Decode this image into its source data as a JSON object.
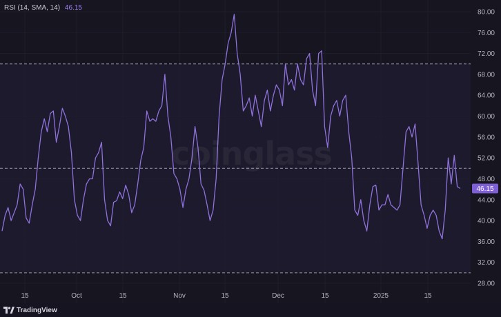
{
  "header": {
    "indicator_label": "RSI (14, SMA, 14)",
    "indicator_value": "46.15"
  },
  "watermark": "coinglass",
  "footer": {
    "brand": "TradingView",
    "logo_icon": "tradingview-logo-icon"
  },
  "colors": {
    "background": "#161520",
    "band_fill": "#1d1a2d",
    "line": "#8f72dc",
    "last_value_tag": "#7e5fd6",
    "axis_text": "#b7b6c0"
  },
  "chart_data": {
    "type": "line",
    "series": [
      {
        "values": [
          38,
          41,
          42.5,
          40,
          41.5,
          43,
          47,
          46,
          40.5,
          39.5,
          43,
          46,
          52,
          57,
          59.5,
          57,
          60.5,
          61,
          55,
          58,
          61.5,
          60,
          58,
          53,
          44,
          41,
          40,
          44,
          47,
          48,
          48,
          52,
          53,
          55,
          44,
          40,
          39,
          43.5,
          43.8,
          45.5,
          44.2,
          46.8,
          45,
          41.5,
          43,
          47,
          51.5,
          54,
          61,
          59,
          59.5,
          59,
          61,
          62,
          68,
          60,
          56,
          49,
          48,
          46,
          42.5,
          46,
          48,
          52,
          58,
          54,
          47,
          45.8,
          43,
          40,
          42,
          48,
          60,
          67,
          70,
          74,
          76,
          79.5,
          72,
          68,
          61,
          62,
          63.5,
          60,
          64,
          61,
          58,
          63,
          65,
          61,
          64,
          66,
          65,
          62,
          70,
          66,
          67,
          65,
          70,
          67,
          66,
          71,
          72,
          65,
          62,
          72,
          72.5,
          58,
          54,
          60,
          62,
          63,
          60,
          63,
          64,
          57,
          52,
          42,
          41,
          44,
          40,
          38,
          43,
          46.5,
          46.8,
          42,
          43,
          43,
          45,
          43,
          42.5,
          42,
          43,
          50,
          57,
          58,
          56,
          58.5,
          51,
          43,
          41,
          38.5,
          41,
          42,
          41,
          38,
          36.5,
          42,
          52,
          47,
          52.5,
          46.5,
          46.15
        ],
        "color": "#8f72dc"
      }
    ],
    "x_ticks": [
      "15",
      "Oct",
      "15",
      "Nov",
      "15",
      "Dec",
      "15",
      "2025",
      "15"
    ],
    "y_ticks": [
      "80.00",
      "76.00",
      "72.00",
      "68.00",
      "64.00",
      "60.00",
      "56.00",
      "52.00",
      "48.00",
      "44.00",
      "40.00",
      "36.00",
      "32.00",
      "28.00"
    ],
    "ylim": [
      28,
      80
    ],
    "bands": [
      {
        "label": "upper",
        "value": 70
      },
      {
        "label": "middle",
        "value": 50
      },
      {
        "label": "lower",
        "value": 30
      }
    ],
    "last_value": 46.15,
    "grid": true
  }
}
